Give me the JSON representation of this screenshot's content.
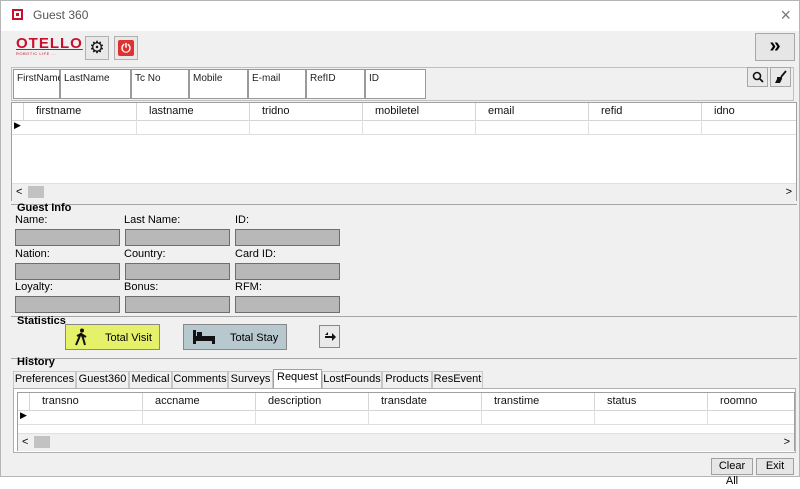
{
  "window": {
    "title": "Guest 360",
    "close_glyph": "×"
  },
  "toolbar": {
    "logo_text": "OTELLO",
    "logo_sub": "ROBOTIC LIFE ...",
    "settings_icon": "gear-icon",
    "power_icon": "power-icon",
    "expand_glyph": "»"
  },
  "search": {
    "fields": [
      {
        "placeholder": "FirstName"
      },
      {
        "placeholder": "LastName"
      },
      {
        "placeholder": "Tc No"
      },
      {
        "placeholder": "Mobile"
      },
      {
        "placeholder": "E-mail"
      },
      {
        "placeholder": "RefID"
      },
      {
        "placeholder": "ID"
      }
    ],
    "search_icon": "search-icon",
    "clear_icon": "broom-icon"
  },
  "guest_grid": {
    "columns": [
      "firstname",
      "lastname",
      "tridno",
      "mobiletel",
      "email",
      "refid",
      "idno"
    ],
    "row_marker": "▶"
  },
  "guest_info": {
    "title": "Guest Info",
    "labels": {
      "name": "Name:",
      "last_name": "Last Name:",
      "id": "ID:",
      "nation": "Nation:",
      "country": "Country:",
      "card_id": "Card ID:",
      "loyalty": "Loyalty:",
      "bonus": "Bonus:",
      "rfm": "RFM:"
    }
  },
  "statistics": {
    "title": "Statistics",
    "total_visit": "Total Visit",
    "total_stay": "Total Stay",
    "colors": {
      "visit_bg": "#e6f16a",
      "stay_bg": "#b8c8cf"
    }
  },
  "history": {
    "title": "History",
    "tabs": [
      "Preferences",
      "Guest360",
      "Medical",
      "Comments",
      "Surveys",
      "Request",
      "LostFounds",
      "Products",
      "ResEvent"
    ],
    "active_tab": "Request",
    "columns": [
      "transno",
      "accname",
      "description",
      "transdate",
      "transtime",
      "status",
      "roomno"
    ]
  },
  "footer": {
    "clear_all": "Clear All",
    "exit": "Exit"
  },
  "scroll": {
    "left_glyph": "<",
    "right_glyph": ">"
  }
}
